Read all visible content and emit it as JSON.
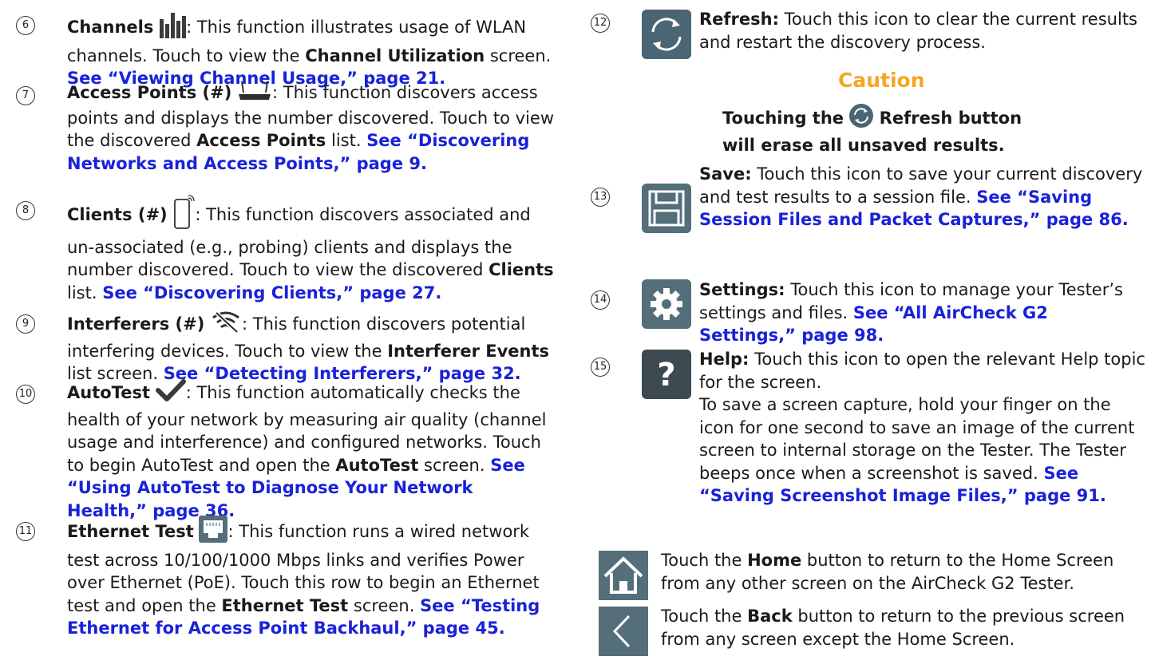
{
  "left_entries": [
    {
      "number": "6",
      "title": "Channels",
      "icon": "channels-bars-icon",
      "text": ": This function illustrates usage of WLAN channels. Touch to view the ",
      "bold_mid": "Channel Utilization",
      "text_after": " screen. ",
      "link": "See “Viewing Channel Usage,” page 21."
    },
    {
      "number": "7",
      "title": "Access Points (#)",
      "icon": "router-icon",
      "text": ": This function discovers access points and displays the number discovered. Touch to view the discovered ",
      "bold_mid": "Access Points",
      "text_after": " list. ",
      "link": "See “Discovering Networks and Access Points,” page 9."
    },
    {
      "number": "8",
      "title": "Clients (#)",
      "icon": "phone-icon",
      "text": ": This function discovers associated and un-associated (e.g., probing) clients and displays the number discovered. Touch to view the discovered ",
      "bold_mid": "Clients",
      "text_after": " list. ",
      "link": "See “Discovering Clients,” page 27."
    },
    {
      "number": "9",
      "title": "Interferers (#)",
      "icon": "interferer-icon",
      "text": ": This function discovers potential interfering devices. Touch to view the ",
      "bold_mid": "Interferer Events",
      "text_after": " list screen. ",
      "link": "See “Detecting Interferers,” page 32."
    },
    {
      "number": "10",
      "title": "AutoTest",
      "icon": "checkmark-icon",
      "text": ": This function automatically checks the health of your network by measuring air quality (channel usage and interference) and configured networks. Touch to begin AutoTest and open the ",
      "bold_mid": "AutoTest",
      "text_after": " screen. ",
      "link": "See “Using AutoTest to Diagnose Your Network Health,” page 36."
    },
    {
      "number": "11",
      "title": "Ethernet Test",
      "icon": "ethernet-port-icon",
      "text": ": This function runs a wired network test across 10/100/1000 Mbps links and verifies Power over Ethernet (PoE). Touch this row to begin an Ethernet test and open the ",
      "bold_mid": "Ethernet Test",
      "text_after": " screen. ",
      "link": "See “Testing Ethernet for Access Point Backhaul,” page 45."
    }
  ],
  "right_entries": [
    {
      "number": "12",
      "title": "Refresh:",
      "icon": "refresh-icon",
      "text": " Touch this icon to clear the current results and restart the discovery process.",
      "link": ""
    },
    {
      "number": "13",
      "title": "Save:",
      "icon": "save-icon",
      "text": " Touch this icon to save your current discovery and test results to a session file. ",
      "link": "See “Saving Session Files and Packet Captures,” page 86."
    },
    {
      "number": "14",
      "title": "Settings:",
      "icon": "gear-icon",
      "text": " Touch this icon to manage your Tester’s settings and files. ",
      "link": "See “All AirCheck G2 Settings,” page 98."
    },
    {
      "number": "15",
      "title": "Help:",
      "icon": "help-icon",
      "text": " Touch this icon to open the relevant Help topic for the screen.",
      "text2": "To save a screen capture, hold your finger on the icon for one second to save an image of the current screen to internal storage on the Tester. The Tester beeps once when a screenshot is saved. ",
      "link": "See “Saving Screenshot Image Files,” page 91."
    }
  ],
  "caution": {
    "title": "Caution",
    "pre": "Touching the ",
    "post": " Refresh button will erase all unsaved results."
  },
  "nav": {
    "home_pre": "Touch the ",
    "home_bold": "Home",
    "home_post": " button to return to the Home Screen from any other screen on the AirCheck G2 Tester.",
    "back_pre": "Touch the ",
    "back_bold": "Back",
    "back_post": " button to return to the previous screen from any screen except the Home Screen."
  },
  "colors": {
    "link": "#1a22d8",
    "caution": "#f5a623",
    "icon_bg": "#546e7a"
  }
}
